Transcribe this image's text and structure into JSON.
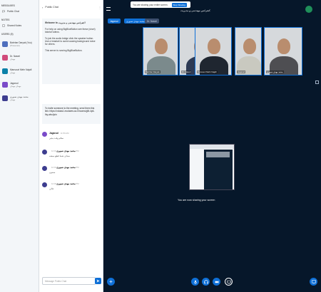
{
  "sidebar": {
    "messages_header": "MESSAGES",
    "public_chat": "Public Chat",
    "notes_header": "NOTES",
    "shared_notes": "Shared Notes",
    "users_header": "USERS (5)",
    "users": [
      {
        "name": "Bahrbar Daryak (You)",
        "sub": "(Presenter)",
        "color": "#4f6fbd"
      },
      {
        "name": "Dr. Naseri",
        "sub": "مهمان",
        "color": "#d14b7b"
      },
      {
        "name": "Mansouri Mehr Najafi",
        "sub": "مهمان",
        "color": "#0b80a8"
      },
      {
        "name": "Jagarud",
        "sub": "مهمان مهمان",
        "color": "#7a4bc9"
      },
      {
        "name": "محمد مهدی صبوری",
        "sub": "مهمان",
        "color": "#3d3d8f"
      }
    ]
  },
  "chat": {
    "title": "Public Chat",
    "welcome": [
      "Welcome to کنفرانس مهندسی و مدیریت!",
      "For help on using BigBlueButton see these (short) tutorial videos.",
      "To join the audio bridge click the speaker button. Use a headset to avoid causing background noise for others.",
      "This server is running BigBlueButton."
    ],
    "invite": "To invite someone to the meeting, send them this link: https://vclass1.modares.ac.ir/rooms/g5t-4p6-lhy-wbc/join",
    "messages": [
      {
        "name": "Jagarud",
        "time": "11:59 AM",
        "text": "سلام وقت بخیر",
        "color": "#7a4bc9"
      },
      {
        "name": "محمد مهدی صبوری",
        "time": "12:01 PM",
        "text": "صدای شما قطع میشه",
        "color": "#3d3d8f"
      },
      {
        "name": "محمد مهدی صبوری",
        "time": "12:01 PM",
        "text": "ممنون",
        "color": "#3d3d8f"
      },
      {
        "name": "محمد مهدی صبوری",
        "time": "12:02 PM",
        "text": "عالی",
        "color": "#3d3d8f"
      }
    ],
    "input_placeholder": "Message Public Chat"
  },
  "main": {
    "banner_text": "You are sharing your entire screen.",
    "stop_sharing": "Stop Sharing",
    "meeting_title": "کنفرانس مهندسی و مدیریت",
    "talker_tags": [
      "Jagarud",
      "محمد مهدی صبوری",
      "Dr. Naseri"
    ],
    "videos": [
      {
        "name": "Bahrbar Daryak",
        "shirt": "#7b8a8c"
      },
      {
        "name": "Dr. Naseri",
        "shirt": "#2e3b55"
      },
      {
        "name": "Mansouri Mehr Najafi",
        "shirt": "#1f2630"
      },
      {
        "name": "Jagarud",
        "shirt": "#c9c9c0"
      },
      {
        "name": "محمد مهدی صبوری",
        "shirt": "#4e4e52"
      }
    ],
    "sharing_text": "You are now sharing your screen"
  },
  "colors": {
    "accent": "#0f70d7",
    "stage_bg": "#06172a",
    "danger": "#e33a3a"
  }
}
